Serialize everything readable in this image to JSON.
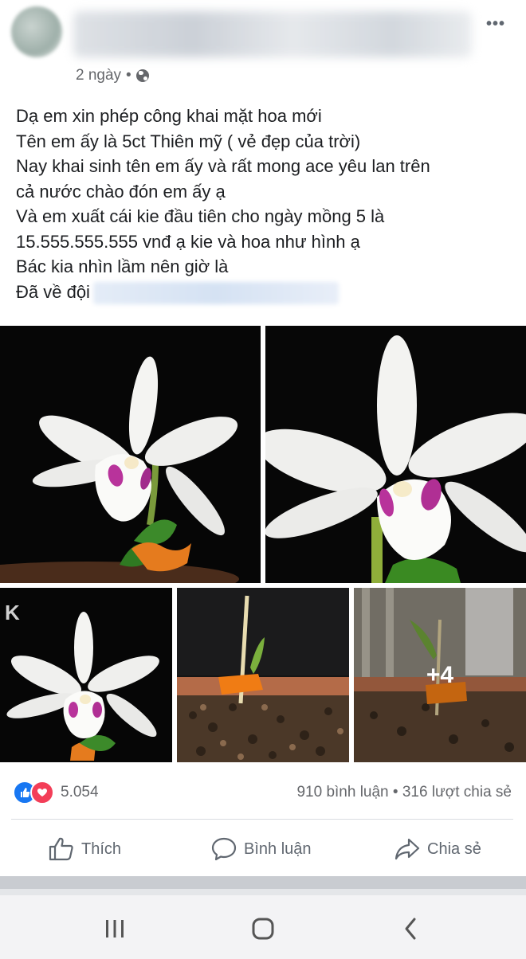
{
  "post": {
    "time": "2 ngày",
    "separator": "•",
    "privacy_icon": "globe-icon",
    "more_icon": "more-dots-icon",
    "text_lines": [
      "Dạ em xin phép công khai mặt hoa mới",
      "Tên em ấy là 5ct Thiên mỹ ( vẻ đẹp của trời)",
      "Nay khai sinh tên em ấy và rất mong ace yêu lan trên",
      "cả nước chào đón em ấy ạ",
      "Và em xuất cái kie đầu tiên cho ngày mồng 5 là",
      "15.555.555.555 vnđ ạ kie và hoa như hình ạ",
      "Bác kia nhìn lầm nên giờ là",
      "Đã về đội"
    ],
    "photos": {
      "count": 5,
      "more_overlay": "+4"
    },
    "reactions": {
      "icons": [
        "like-icon",
        "love-icon"
      ],
      "count": "5.054",
      "comments": "910 bình luận",
      "dot": "•",
      "shares": "316 lượt chia sẻ"
    },
    "actions": {
      "like": "Thích",
      "comment": "Bình luận",
      "share": "Chia sẻ"
    }
  },
  "colors": {
    "like_blue": "#1877f2",
    "love_red": "#f33e58",
    "text": "#1c1e21",
    "meta": "#65676b"
  },
  "system_nav": {
    "icons": [
      "recent-apps-icon",
      "home-icon",
      "back-icon"
    ]
  }
}
